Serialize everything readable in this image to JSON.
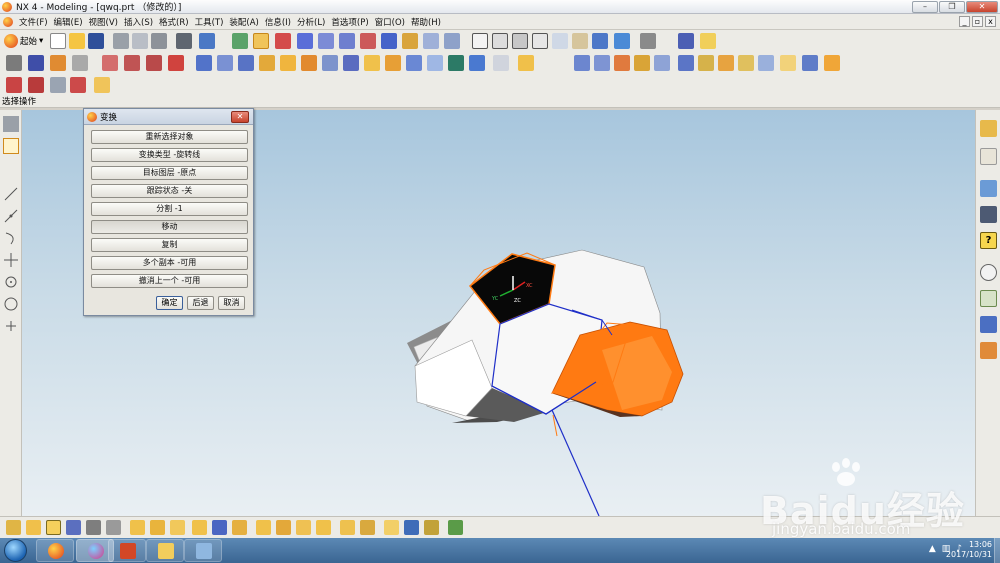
{
  "window": {
    "title": "NX 4 - Modeling - [qwq.prt （修改的）]",
    "controls": [
      "–",
      "❐",
      "✕"
    ]
  },
  "menubar": {
    "items": [
      "文件(F)",
      "编辑(E)",
      "视图(V)",
      "插入(S)",
      "格式(R)",
      "工具(T)",
      "装配(A)",
      "信息(I)",
      "分析(L)",
      "首选项(P)",
      "窗口(O)",
      "帮助(H)"
    ],
    "mdi_controls": [
      "_",
      "▫",
      "x"
    ]
  },
  "toolbar": {
    "start_label": "起始",
    "start_arrow": "▾"
  },
  "selection_bar": {
    "label": "选择操作"
  },
  "dialog": {
    "title": "变换",
    "close": "✕",
    "buttons": [
      "重新选择对象",
      "变换类型 -旋转线",
      "目标图层 -原点",
      "跟踪状态 -关",
      "分割 -1",
      "移动",
      "复制",
      "多个副本 -可用",
      "撤消上一个 -可用"
    ],
    "ok": "确定",
    "back": "后退",
    "cancel": "取消"
  },
  "csys": {
    "xc": "XC",
    "yc": "YC",
    "zc": "ZC"
  },
  "taskbar": {
    "tray_flag": "▲",
    "clock_time": "13:06",
    "clock_date": "2017/10/31"
  },
  "watermark": {
    "brand": "Baidu经验",
    "url": "jingyan.baidu.com"
  },
  "colors": {
    "viewport_top": "#a7c6dd",
    "viewport_bottom": "#e9eff3",
    "highlight_orange": "#ff7a12",
    "selection_blue": "#1f2fc8",
    "taskbar": "#3a6592"
  },
  "icons": {
    "toolbar_row1": [
      "new-icon",
      "open-icon",
      "save-icon",
      "cut-icon",
      "copy-icon",
      "paste-icon",
      "undo-icon",
      "repeat-icon",
      "select-icon",
      "snap-icon",
      "point-icon",
      "fit-icon",
      "zoom-icon",
      "rotate-icon",
      "pan-icon",
      "view-orient-icon",
      "render-style-icon",
      "layer-icon"
    ],
    "toolbar_row2": [
      "sketch-icon",
      "extrude-icon",
      "revolve-icon",
      "hole-icon",
      "boss-icon",
      "pocket-icon",
      "blend-icon",
      "chamfer-icon",
      "shell-icon",
      "pattern-icon",
      "mirror-icon",
      "trim-icon",
      "surface-icon"
    ],
    "right_toolbar": [
      "assembly-navigator-icon",
      "part-navigator-icon",
      "web-browser-icon",
      "training-icon",
      "help-icon",
      "history-icon",
      "system-materials-icon",
      "reuse-library-icon",
      "roles-icon"
    ],
    "left_toolbar": [
      "select-filter-icon",
      "snap-point-icon",
      "line-icon",
      "arc-icon",
      "circle-icon",
      "point-icon"
    ]
  }
}
